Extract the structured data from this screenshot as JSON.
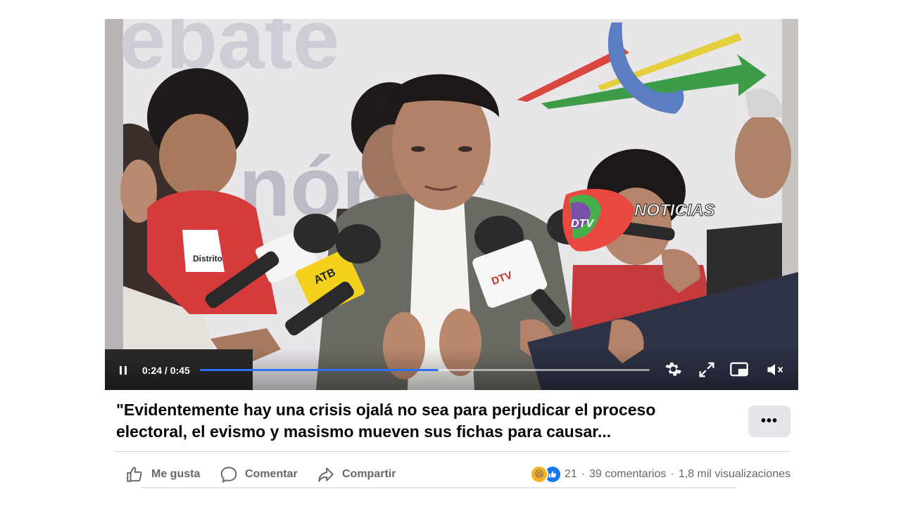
{
  "video": {
    "overlay_brand": "NOTICIAS",
    "mic_labels": [
      "ATB",
      "DTV"
    ],
    "jacket_text": "Distrito",
    "controls": {
      "current_time": "0:24",
      "separator": "/",
      "duration": "0:45",
      "progress_fraction": 0.53
    },
    "icons": [
      "pause-icon",
      "settings-gear-icon",
      "fullscreen-expand-icon",
      "picture-in-picture-icon",
      "volume-muted-icon"
    ]
  },
  "post": {
    "caption": "\"Evidentemente hay una crisis ojalá no sea para perjudicar el proceso electoral, el evismo y masismo mueven sus fichas para causar...",
    "more_label": "•••"
  },
  "actions": {
    "like": "Me gusta",
    "comment": "Comentar",
    "share": "Compartir"
  },
  "stats": {
    "reaction_count": "21",
    "comments": "39 comentarios",
    "dot": "·",
    "views": "1,8 mil visualizaciones"
  },
  "colors": {
    "progress": "#2d6ef5",
    "like_blue": "#1877f2",
    "muted_text": "#65676b"
  }
}
